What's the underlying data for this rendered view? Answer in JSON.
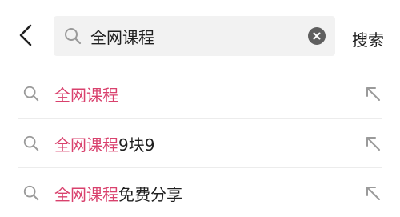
{
  "search": {
    "query": "全网课程",
    "action_label": "搜索"
  },
  "suggestions": [
    {
      "highlight": "全网课程",
      "rest": ""
    },
    {
      "highlight": "全网课程",
      "rest": "9块9"
    },
    {
      "highlight": "全网课程",
      "rest": "免费分享"
    }
  ],
  "colors": {
    "highlight": "#d9416d",
    "text": "#1f1f1f",
    "icon": "#9a9a9a",
    "search_bg": "#f2f2f2",
    "clear_bg": "#5f5f5f"
  },
  "icons": {
    "back": "back-chevron-icon",
    "search": "search-icon",
    "clear": "clear-icon",
    "fill_query": "arrow-up-left-icon"
  }
}
